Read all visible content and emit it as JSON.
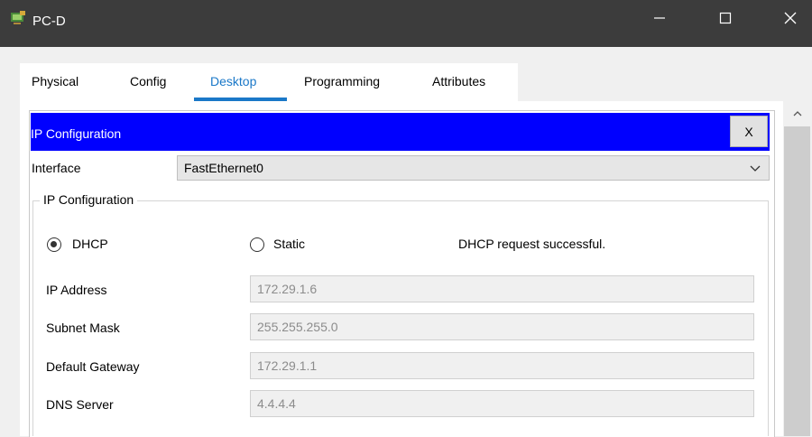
{
  "window": {
    "title": "PC-D"
  },
  "tabs": [
    {
      "label": "Physical"
    },
    {
      "label": "Config"
    },
    {
      "label": "Desktop"
    },
    {
      "label": "Programming"
    },
    {
      "label": "Attributes"
    }
  ],
  "active_tab": "Desktop",
  "ip_config": {
    "title": "IP Configuration",
    "close_label": "X",
    "interface_label": "Interface",
    "interface_value": "FastEthernet0",
    "group_label": "IP Configuration",
    "dhcp_label": "DHCP",
    "static_label": "Static",
    "selected_mode": "DHCP",
    "status": "DHCP request successful.",
    "fields": [
      {
        "label": "IP Address",
        "value": "172.29.1.6"
      },
      {
        "label": "Subnet Mask",
        "value": "255.255.255.0"
      },
      {
        "label": "Default Gateway",
        "value": "172.29.1.1"
      },
      {
        "label": "DNS Server",
        "value": "4.4.4.4"
      }
    ]
  },
  "colors": {
    "titlebar": "#3c3c3c",
    "accent_tab": "#1a78c8",
    "header_blue": "#0000ff"
  },
  "icons": {
    "app": "pc-icon",
    "minimize": "minimize-icon",
    "maximize": "maximize-icon",
    "close": "close-icon",
    "dropdown": "chevron-down-icon",
    "scroll_up": "scroll-up-icon"
  }
}
